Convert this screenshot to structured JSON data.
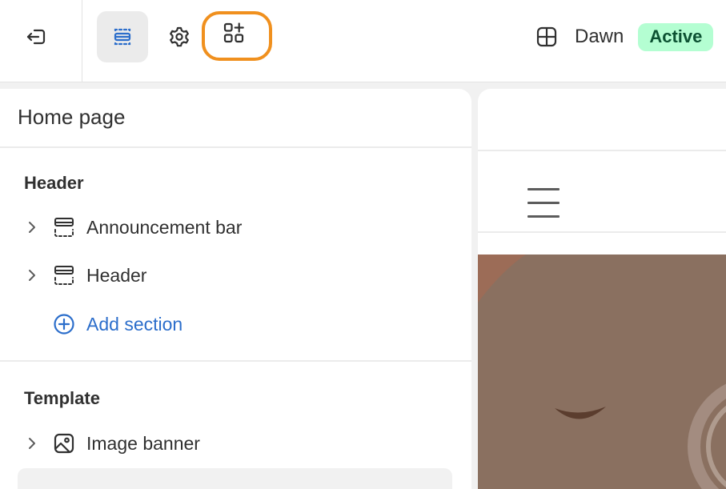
{
  "topbar": {
    "exit_icon": "exit-icon",
    "sections_icon": "sections-icon",
    "settings_icon": "gear-icon",
    "apps_icon": "apps-add-icon",
    "theme_icon": "theme-layout-icon",
    "theme_name": "Dawn",
    "theme_status": "Active"
  },
  "panel": {
    "title": "Home page",
    "groups": {
      "header": {
        "title": "Header",
        "items": [
          {
            "label": "Announcement bar",
            "icon": "section-icon"
          },
          {
            "label": "Header",
            "icon": "section-icon"
          }
        ],
        "add_label": "Add section"
      },
      "template": {
        "title": "Template",
        "items": [
          {
            "label": "Image banner",
            "icon": "image-icon"
          }
        ]
      }
    }
  },
  "preview": {
    "menu_icon": "hamburger-menu-icon"
  },
  "colors": {
    "accent_orange": "#f0901e",
    "link_blue": "#2c6ecb",
    "active_badge_bg": "#b4fed2",
    "active_badge_text": "#0c5132",
    "banner_bg": "#8a7060"
  }
}
